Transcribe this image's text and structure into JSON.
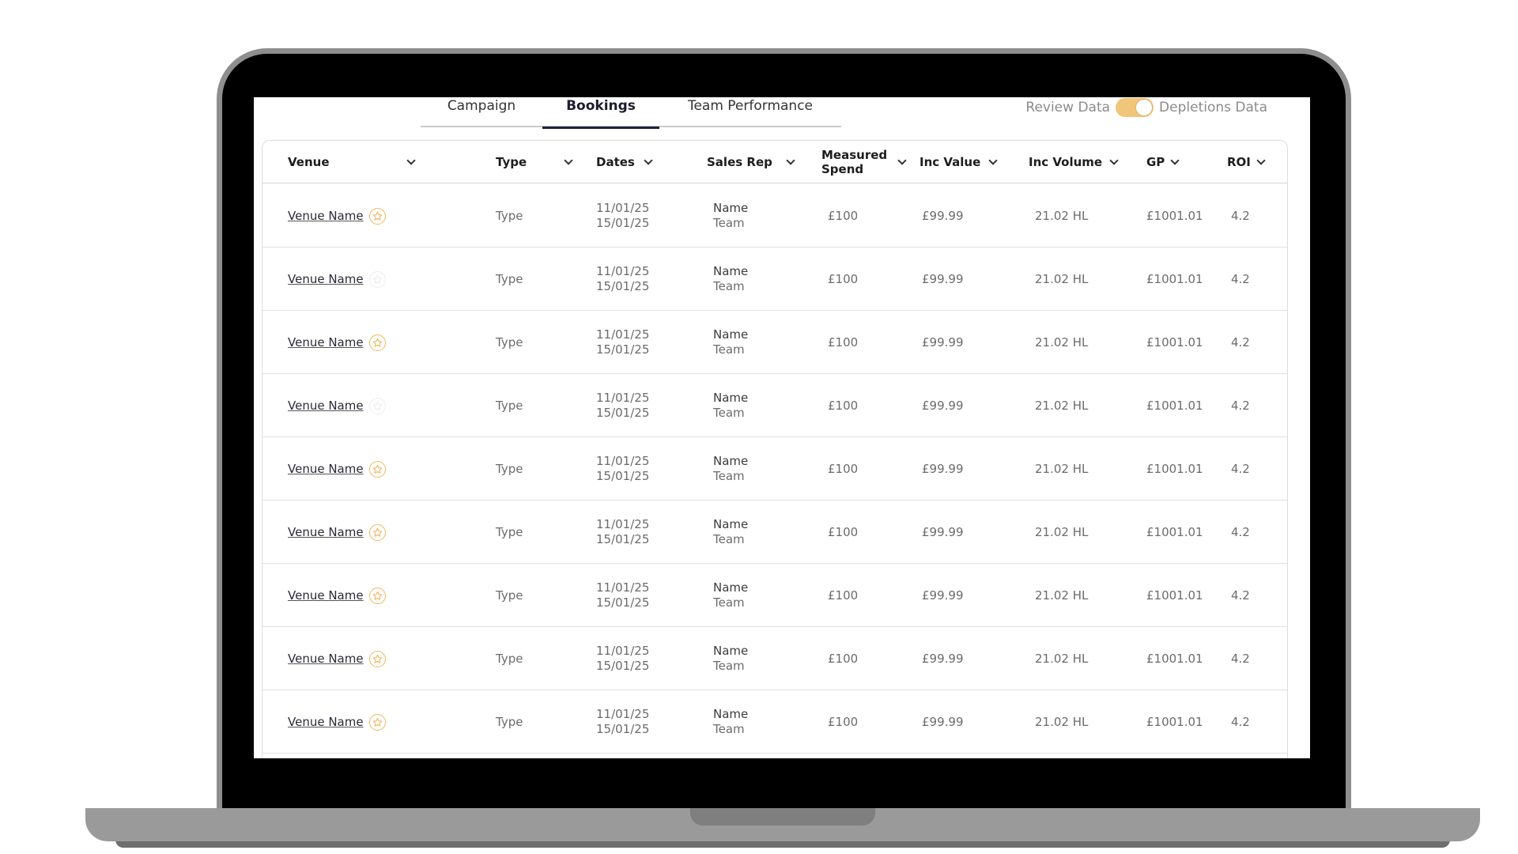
{
  "tabs": [
    {
      "label": "Campaign"
    },
    {
      "label": "Bookings"
    },
    {
      "label": "Team Performance"
    }
  ],
  "toggle": {
    "left_label": "Review Data",
    "right_label": "Depletions Data",
    "accent_color": "#f2c67a"
  },
  "columns": {
    "venue": "Venue",
    "type": "Type",
    "dates": "Dates",
    "sales_rep": "Sales Rep",
    "measured_spend": "Measured Spend",
    "inc_value": "Inc Value",
    "inc_volume": "Inc Volume",
    "gp": "GP",
    "roi": "ROI"
  },
  "rows": [
    {
      "venue": "Venue Name",
      "starred": true,
      "type": "Type",
      "start": "11/01/25",
      "end": "15/01/25",
      "rep_name": "Name",
      "rep_team": "Team",
      "spend": "£100",
      "inc_value": "£99.99",
      "inc_volume": "21.02 HL",
      "gp": "£1001.01",
      "roi": "4.2"
    },
    {
      "venue": "Venue Name",
      "starred": false,
      "type": "Type",
      "start": "11/01/25",
      "end": "15/01/25",
      "rep_name": "Name",
      "rep_team": "Team",
      "spend": "£100",
      "inc_value": "£99.99",
      "inc_volume": "21.02 HL",
      "gp": "£1001.01",
      "roi": "4.2"
    },
    {
      "venue": "Venue Name",
      "starred": true,
      "type": "Type",
      "start": "11/01/25",
      "end": "15/01/25",
      "rep_name": "Name",
      "rep_team": "Team",
      "spend": "£100",
      "inc_value": "£99.99",
      "inc_volume": "21.02 HL",
      "gp": "£1001.01",
      "roi": "4.2"
    },
    {
      "venue": "Venue Name",
      "starred": false,
      "type": "Type",
      "start": "11/01/25",
      "end": "15/01/25",
      "rep_name": "Name",
      "rep_team": "Team",
      "spend": "£100",
      "inc_value": "£99.99",
      "inc_volume": "21.02 HL",
      "gp": "£1001.01",
      "roi": "4.2"
    },
    {
      "venue": "Venue Name",
      "starred": true,
      "type": "Type",
      "start": "11/01/25",
      "end": "15/01/25",
      "rep_name": "Name",
      "rep_team": "Team",
      "spend": "£100",
      "inc_value": "£99.99",
      "inc_volume": "21.02 HL",
      "gp": "£1001.01",
      "roi": "4.2"
    },
    {
      "venue": "Venue Name",
      "starred": true,
      "type": "Type",
      "start": "11/01/25",
      "end": "15/01/25",
      "rep_name": "Name",
      "rep_team": "Team",
      "spend": "£100",
      "inc_value": "£99.99",
      "inc_volume": "21.02 HL",
      "gp": "£1001.01",
      "roi": "4.2"
    },
    {
      "venue": "Venue Name",
      "starred": true,
      "type": "Type",
      "start": "11/01/25",
      "end": "15/01/25",
      "rep_name": "Name",
      "rep_team": "Team",
      "spend": "£100",
      "inc_value": "£99.99",
      "inc_volume": "21.02 HL",
      "gp": "£1001.01",
      "roi": "4.2"
    },
    {
      "venue": "Venue Name",
      "starred": true,
      "type": "Type",
      "start": "11/01/25",
      "end": "15/01/25",
      "rep_name": "Name",
      "rep_team": "Team",
      "spend": "£100",
      "inc_value": "£99.99",
      "inc_volume": "21.02 HL",
      "gp": "£1001.01",
      "roi": "4.2"
    },
    {
      "venue": "Venue Name",
      "starred": true,
      "type": "Type",
      "start": "11/01/25",
      "end": "15/01/25",
      "rep_name": "Name",
      "rep_team": "Team",
      "spend": "£100",
      "inc_value": "£99.99",
      "inc_volume": "21.02 HL",
      "gp": "£1001.01",
      "roi": "4.2"
    }
  ],
  "icons": {
    "star": "star-icon",
    "chevron": "chevron-down-icon"
  },
  "colors": {
    "star_active": "#f1b660",
    "star_inactive": "#ececec",
    "tab_underline": "#1f2340"
  }
}
